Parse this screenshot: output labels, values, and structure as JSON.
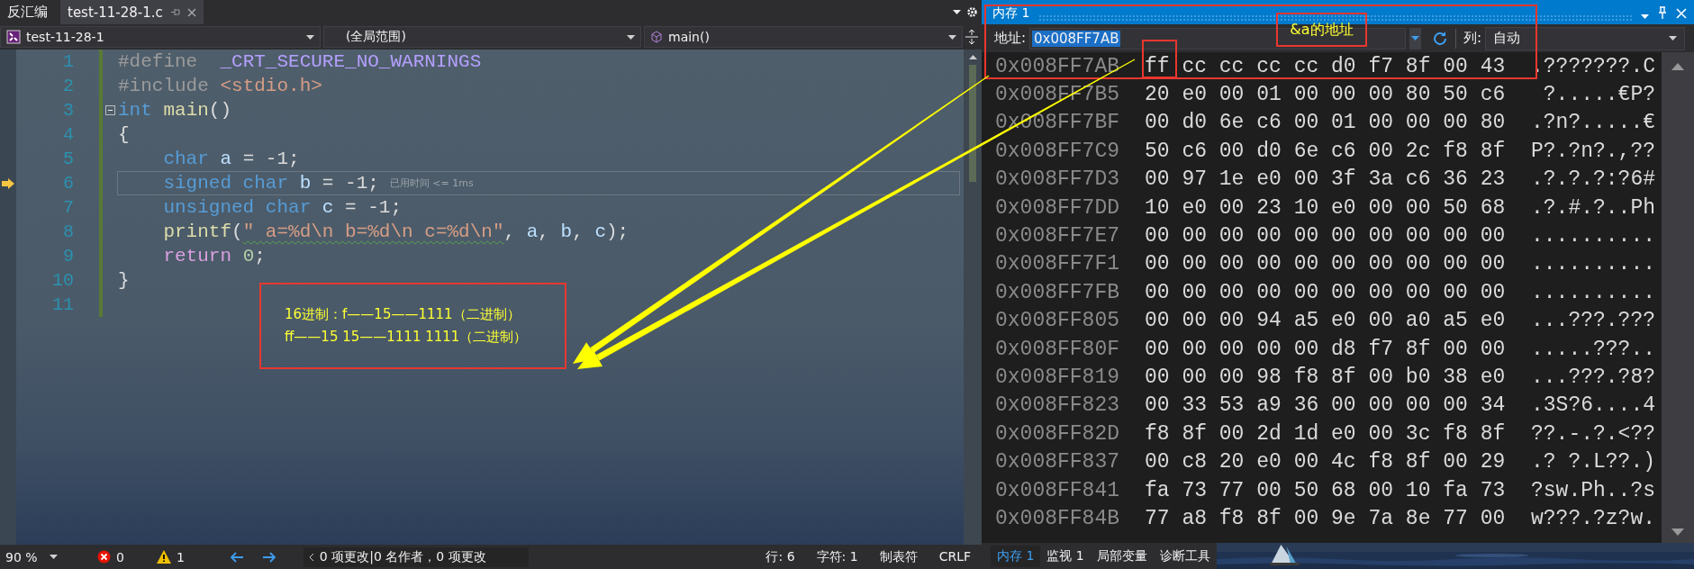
{
  "editor_tabs": [
    {
      "label": "反汇编",
      "selected": false
    },
    {
      "label": "test-11-28-1.c",
      "selected": true
    }
  ],
  "nav": {
    "project": "test-11-28-1",
    "scope": "(全局范围)",
    "member": "main()"
  },
  "code_lines": [
    {
      "number": "1",
      "tokens": [
        {
          "text": "#define  ",
          "kind": "pre"
        },
        {
          "text": "_CRT_SECURE_NO_WARNINGS",
          "kind": "macro"
        }
      ]
    },
    {
      "number": "2",
      "tokens": [
        {
          "text": "#include ",
          "kind": "pre"
        },
        {
          "text": "<stdio.h>",
          "kind": "str"
        }
      ]
    },
    {
      "number": "3",
      "fold": true,
      "tokens": [
        {
          "text": "int ",
          "kind": "kw"
        },
        {
          "text": "main",
          "kind": "func"
        },
        {
          "text": "()",
          "kind": "plain"
        }
      ]
    },
    {
      "number": "4",
      "tokens": [
        {
          "text": "{",
          "kind": "plain"
        }
      ]
    },
    {
      "number": "5",
      "tokens": [
        {
          "text": "    char ",
          "kind": "kw"
        },
        {
          "text": "a",
          "kind": "var"
        },
        {
          "text": " = -1;",
          "kind": "plain"
        }
      ]
    },
    {
      "number": "6",
      "current": true,
      "hint": "已用时间 <= 1ms",
      "tokens": [
        {
          "text": "    signed char ",
          "kind": "kw"
        },
        {
          "text": "b",
          "kind": "var"
        },
        {
          "text": " = -1;",
          "kind": "plain"
        }
      ]
    },
    {
      "number": "7",
      "tokens": [
        {
          "text": "    unsigned char ",
          "kind": "kw"
        },
        {
          "text": "c",
          "kind": "var"
        },
        {
          "text": " = -1;",
          "kind": "plain"
        }
      ]
    },
    {
      "number": "8",
      "tokens": [
        {
          "text": "    printf",
          "kind": "func"
        },
        {
          "text": "(",
          "kind": "plain"
        },
        {
          "text": "\" a=%d\\n b=%d\\n c=%d\\n\"",
          "kind": "str",
          "squiggle": true
        },
        {
          "text": ", ",
          "kind": "plain"
        },
        {
          "text": "a",
          "kind": "var"
        },
        {
          "text": ", ",
          "kind": "plain"
        },
        {
          "text": "b",
          "kind": "var"
        },
        {
          "text": ", ",
          "kind": "plain"
        },
        {
          "text": "c",
          "kind": "var"
        },
        {
          "text": ");",
          "kind": "plain"
        }
      ]
    },
    {
      "number": "9",
      "tokens": [
        {
          "text": "    return ",
          "kind": "ctl"
        },
        {
          "text": "0",
          "kind": "num"
        },
        {
          "text": ";",
          "kind": "plain"
        }
      ]
    },
    {
      "number": "10",
      "tokens": [
        {
          "text": "}",
          "kind": "plain"
        }
      ]
    },
    {
      "number": "11"
    }
  ],
  "status": {
    "zoom": "90 %",
    "errors": "0",
    "warnings": "1",
    "changes": "0 项更改|0 名作者，0 项更改",
    "line": "行: 6",
    "char": "字符: 1",
    "indent": "制表符",
    "eol": "CRLF"
  },
  "memory": {
    "title": "内存 1",
    "address_label": "地址:",
    "address": "0x008FF7AB",
    "address_selected": true,
    "columns_label": "列:",
    "columns": "自动",
    "rows": [
      {
        "address": "0x008FF7AB",
        "bytes": [
          "ff",
          "cc",
          "cc",
          "cc",
          "cc",
          "d0",
          "f7",
          "8f",
          "00",
          "43"
        ],
        "ascii": ".???????.C"
      },
      {
        "address": "0x008FF7B5",
        "bytes": [
          "20",
          "e0",
          "00",
          "01",
          "00",
          "00",
          "00",
          "80",
          "50",
          "c6"
        ],
        "ascii": " ?.....€P?"
      },
      {
        "address": "0x008FF7BF",
        "bytes": [
          "00",
          "d0",
          "6e",
          "c6",
          "00",
          "01",
          "00",
          "00",
          "00",
          "80"
        ],
        "ascii": ".?n?.....€"
      },
      {
        "address": "0x008FF7C9",
        "bytes": [
          "50",
          "c6",
          "00",
          "d0",
          "6e",
          "c6",
          "00",
          "2c",
          "f8",
          "8f"
        ],
        "ascii": "P?.?n?.,??"
      },
      {
        "address": "0x008FF7D3",
        "bytes": [
          "00",
          "97",
          "1e",
          "e0",
          "00",
          "3f",
          "3a",
          "c6",
          "36",
          "23"
        ],
        "ascii": ".?.?.?:?6#"
      },
      {
        "address": "0x008FF7DD",
        "bytes": [
          "10",
          "e0",
          "00",
          "23",
          "10",
          "e0",
          "00",
          "00",
          "50",
          "68"
        ],
        "ascii": ".?.#.?..Ph"
      },
      {
        "address": "0x008FF7E7",
        "bytes": [
          "00",
          "00",
          "00",
          "00",
          "00",
          "00",
          "00",
          "00",
          "00",
          "00"
        ],
        "ascii": ".........."
      },
      {
        "address": "0x008FF7F1",
        "bytes": [
          "00",
          "00",
          "00",
          "00",
          "00",
          "00",
          "00",
          "00",
          "00",
          "00"
        ],
        "ascii": ".........."
      },
      {
        "address": "0x008FF7FB",
        "bytes": [
          "00",
          "00",
          "00",
          "00",
          "00",
          "00",
          "00",
          "00",
          "00",
          "00"
        ],
        "ascii": ".........."
      },
      {
        "address": "0x008FF805",
        "bytes": [
          "00",
          "00",
          "00",
          "94",
          "a5",
          "e0",
          "00",
          "a0",
          "a5",
          "e0"
        ],
        "ascii": "...???.???"
      },
      {
        "address": "0x008FF80F",
        "bytes": [
          "00",
          "00",
          "00",
          "00",
          "00",
          "d8",
          "f7",
          "8f",
          "00",
          "00"
        ],
        "ascii": ".....???.."
      },
      {
        "address": "0x008FF819",
        "bytes": [
          "00",
          "00",
          "00",
          "98",
          "f8",
          "8f",
          "00",
          "b0",
          "38",
          "e0"
        ],
        "ascii": "...???.?8?"
      },
      {
        "address": "0x008FF823",
        "bytes": [
          "00",
          "33",
          "53",
          "a9",
          "36",
          "00",
          "00",
          "00",
          "00",
          "34"
        ],
        "ascii": ".3S?6....4"
      },
      {
        "address": "0x008FF82D",
        "bytes": [
          "f8",
          "8f",
          "00",
          "2d",
          "1d",
          "e0",
          "00",
          "3c",
          "f8",
          "8f"
        ],
        "ascii": "??.-.?.<??"
      },
      {
        "address": "0x008FF837",
        "bytes": [
          "00",
          "c8",
          "20",
          "e0",
          "00",
          "4c",
          "f8",
          "8f",
          "00",
          "29"
        ],
        "ascii": ".? ?.L??.)"
      },
      {
        "address": "0x008FF841",
        "bytes": [
          "fa",
          "73",
          "77",
          "00",
          "50",
          "68",
          "00",
          "10",
          "fa",
          "73"
        ],
        "ascii": "?sw.Ph..?s"
      },
      {
        "address": "0x008FF84B",
        "bytes": [
          "77",
          "a8",
          "f8",
          "8f",
          "00",
          "9e",
          "7a",
          "8e",
          "77",
          "00"
        ],
        "ascii": "w???.?z?w."
      }
    ]
  },
  "bottom_tabs": [
    {
      "label": "内存 1",
      "selected": true
    },
    {
      "label": "监视 1",
      "selected": false
    },
    {
      "label": "局部变量",
      "selected": false
    },
    {
      "label": "诊断工具",
      "selected": false
    }
  ],
  "annotations": {
    "address_note": "&a的地址",
    "note_lines": [
      "16进制：f——15——1111（二进制）",
      "ff——15 15——1111 1111（二进制）"
    ]
  }
}
